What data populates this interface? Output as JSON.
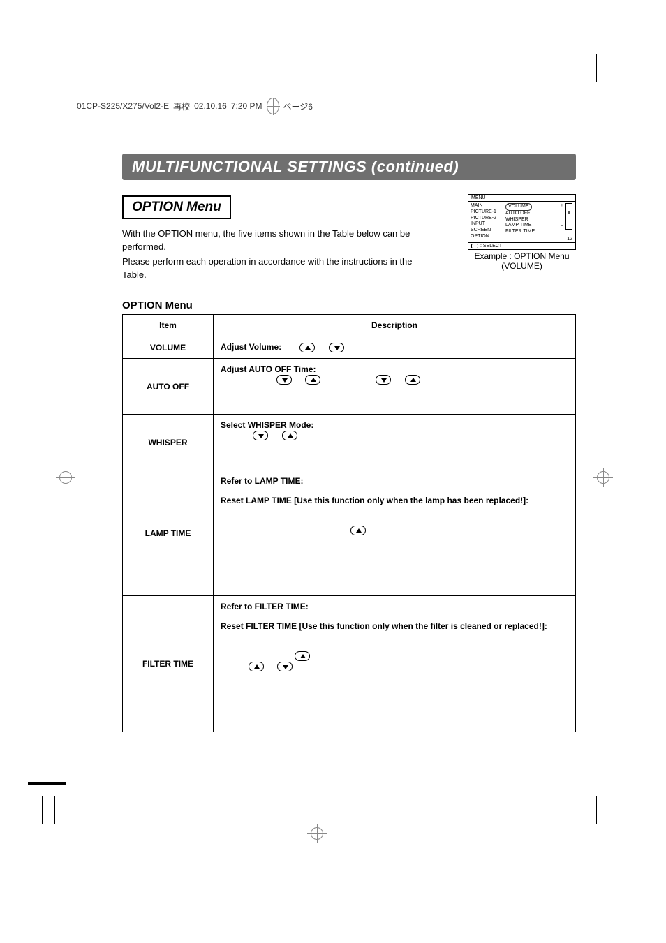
{
  "header_strip": {
    "file": "01CP-S225/X275/Vol2-E",
    "kanji": "再校",
    "date": "02.10.16",
    "time": "7:20 PM",
    "page": "ページ6"
  },
  "title_band": "MULTIFUNCTIONAL SETTINGS (continued)",
  "section_box": "OPTION Menu",
  "intro_line1": "With the OPTION menu, the five items shown in the Table below can be performed.",
  "intro_line2": "Please perform each operation in accordance with the instructions in the Table.",
  "osd": {
    "title": "MENU",
    "left_items": [
      "MAIN",
      "PICTURE-1",
      "PICTURE-2",
      "INPUT",
      "SCREEN",
      "OPTION"
    ],
    "right_items": [
      "VOLUME",
      "AUTO OFF",
      "WHISPER",
      "LAMP TIME",
      "FILTER TIME"
    ],
    "number": "12",
    "footer": ": SELECT",
    "caption_line1": "Example : OPTION Menu",
    "caption_line2": "(VOLUME)"
  },
  "table_heading": "OPTION Menu",
  "table": {
    "headers": {
      "item": "Item",
      "desc": "Description"
    },
    "rows": [
      {
        "item": "VOLUME",
        "label": "Adjust Volume:"
      },
      {
        "item": "AUTO OFF",
        "label": "Adjust AUTO OFF Time:"
      },
      {
        "item": "WHISPER",
        "label": "Select WHISPER Mode:"
      },
      {
        "item": "LAMP TIME",
        "label": "Refer to LAMP TIME:",
        "extra": "Reset LAMP TIME  [Use this function only when the lamp has been replaced!]:"
      },
      {
        "item": "FILTER TIME",
        "label": "Refer to FILTER TIME:",
        "extra": "Reset FILTER TIME [Use this function only when the filter is cleaned or replaced!]:"
      }
    ]
  }
}
